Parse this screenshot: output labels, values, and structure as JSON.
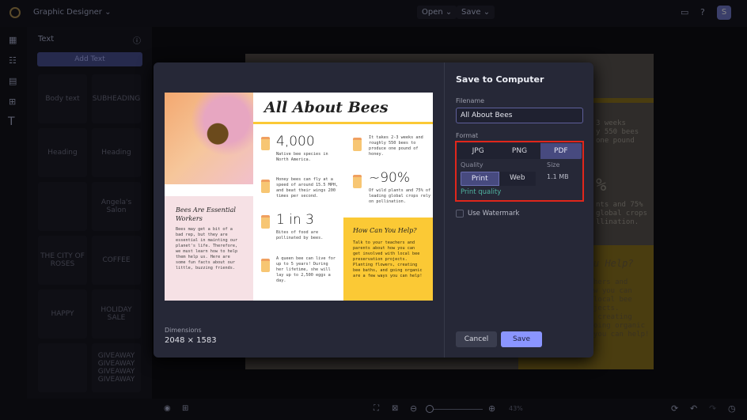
{
  "topbar": {
    "project": "Graphic Designer",
    "open": "Open",
    "save": "Save",
    "avatar": "S"
  },
  "panel": {
    "title": "Text",
    "add_text": "Add Text",
    "tiles": [
      "Body text",
      "SUBHEADING",
      "Heading",
      "Heading",
      "",
      "Angela's Salon",
      "THE CITY OF ROSES",
      "COFFEE",
      "HAPPY",
      "HOLIDAY SALE",
      "",
      "GIVEAWAY GIVEAWAY GIVEAWAY GIVEAWAY"
    ]
  },
  "background_doc": {
    "frag1": "3 weeks\ny 550 bees\none pound",
    "frag2": "%",
    "frag3": "nts and 75%\nglobal crops\nllination.",
    "frag4": "u Help?",
    "frag5": "hers and\nw you can\nlocal bee\njects.\n creating\noing organic\nyou can help!"
  },
  "preview": {
    "title": "All About Bees",
    "stat1": "4,000",
    "stat1_text": "Native bee species in North America.",
    "fact2": "Honey bees can fly at a speed of around 15.5 MPH, and beat their wings 200 times per second.",
    "stat3": "1 in 3",
    "stat3_text": "Bites of food are pollinated by bees.",
    "fact4": "A queen bee can live for up to 5 years! During her lifetime, she will lay up to 2,500 eggs a day.",
    "fact5": "It takes 2-3 weeks and roughly 550 bees to produce one pound of honey.",
    "stat6": "~90%",
    "stat6_text": "Of wild plants and 75% of leading global crops rely on pollination.",
    "pink_title": "Bees Are Essential Workers",
    "pink_text": "Bees may get a bit of a bad rep, but they are essential in mainting our planet's life. Therefore, we must learn how to help them help us. Here are some fun facts about our little, buzzing friends.",
    "help_title": "How Can You Help?",
    "help_text": "Talk to your teachers and parents about how you can get involved with local bee preservation projects. Planting flowers, creating bee baths, and going organic are a few ways you can help!"
  },
  "modal": {
    "title": "Save to Computer",
    "filename_label": "Filename",
    "filename": "All About Bees",
    "format_label": "Format",
    "formats": [
      "JPG",
      "PNG",
      "PDF"
    ],
    "selected_format": "PDF",
    "quality_label": "Quality",
    "qualities": [
      "Print",
      "Web"
    ],
    "selected_quality": "Print",
    "size_label": "Size",
    "size": "1.1 MB",
    "quality_note": "Print quality",
    "watermark": "Use Watermark",
    "watermark_checked": false,
    "dimensions_label": "Dimensions",
    "dimensions": "2048 × 1583",
    "cancel": "Cancel",
    "save": "Save"
  },
  "bottombar": {
    "zoom": "43%"
  },
  "colors": {
    "accent": "#8a95ff",
    "highlight": "#e0261b",
    "note": "#4fb3a0"
  }
}
